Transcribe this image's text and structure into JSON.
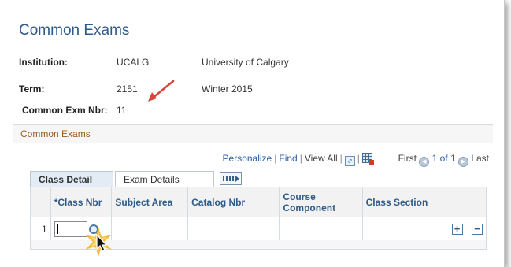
{
  "page": {
    "title": "Common Exams"
  },
  "fields": {
    "institution": {
      "label": "Institution:",
      "code": "UCALG",
      "description": "University of Calgary"
    },
    "term": {
      "label": "Term:",
      "code": "2151",
      "description": "Winter 2015"
    },
    "common_exm_nbr": {
      "label": "Common Exm Nbr:",
      "value": "11"
    }
  },
  "section": {
    "title": "Common Exams"
  },
  "grid_nav": {
    "personalize": "Personalize",
    "find": "Find",
    "view_all": "View All",
    "first": "First",
    "range": "1 of 1",
    "last": "Last"
  },
  "tabs": [
    {
      "label": "Class Detail",
      "active": true
    },
    {
      "label": "Exam Details",
      "active": false
    }
  ],
  "table": {
    "columns": [
      "*Class Nbr",
      "Subject Area",
      "Catalog Nbr",
      "Course Component",
      "Class Section"
    ],
    "rows": [
      {
        "row_num": "1",
        "class_nbr": ""
      }
    ]
  },
  "icons": {
    "arrow": "red-pointer-arrow",
    "lookup": "magnifier-icon",
    "add": "plus-icon",
    "remove": "minus-icon"
  },
  "colors": {
    "title": "#2d5a89",
    "section_title": "#a05a1a",
    "arrow": "#d9453a",
    "burst": "#f2b632"
  }
}
